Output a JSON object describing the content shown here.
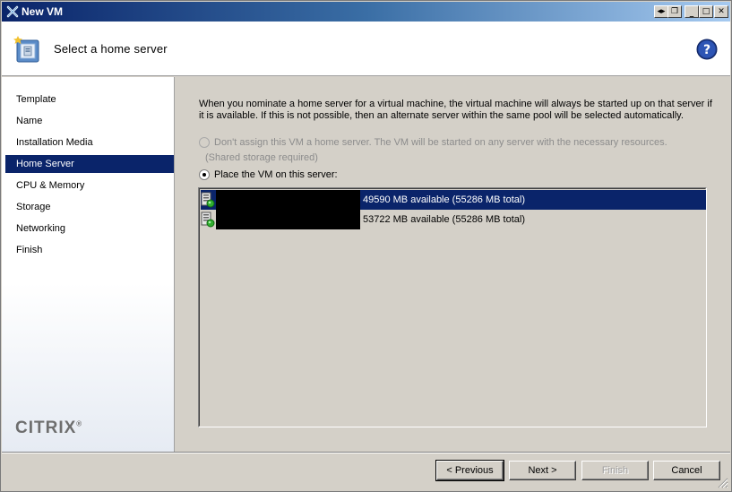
{
  "window": {
    "title": "New VM",
    "controls": [
      "pin-icon",
      "restore-icon",
      "minimize-icon",
      "maximize-icon",
      "close-icon"
    ]
  },
  "header": {
    "title": "Select a home server",
    "icon": "new-vm-icon",
    "help_icon": "help-icon"
  },
  "sidebar": {
    "items": [
      {
        "label": "Template"
      },
      {
        "label": "Name"
      },
      {
        "label": "Installation Media"
      },
      {
        "label": "Home Server"
      },
      {
        "label": "CPU & Memory"
      },
      {
        "label": "Storage"
      },
      {
        "label": "Networking"
      },
      {
        "label": "Finish"
      }
    ],
    "selected_index": 3,
    "logo": "CITRIX",
    "logo_mark": "®"
  },
  "content": {
    "description": "When you nominate a home server for a virtual machine, the virtual machine will always be started up on that server if it is available. If this is not possible, then an alternate server within the same pool will be selected automatically.",
    "option_no_home": "Don't assign this VM a home server. The VM will be started on any server with the necessary resources.",
    "option_no_home_note": "(Shared storage required)",
    "option_place": "Place the VM on this server:",
    "servers": [
      {
        "memory": "49590 MB available (55286 MB total)",
        "selected": true
      },
      {
        "memory": "53722 MB available (55286 MB total)",
        "selected": false
      }
    ]
  },
  "footer": {
    "previous_label": "< Previous",
    "next_label": "Next >",
    "finish_label": "Finish",
    "cancel_label": "Cancel"
  },
  "colors": {
    "selection": "#0a246a",
    "dialog_bg": "#d4d0c8"
  }
}
